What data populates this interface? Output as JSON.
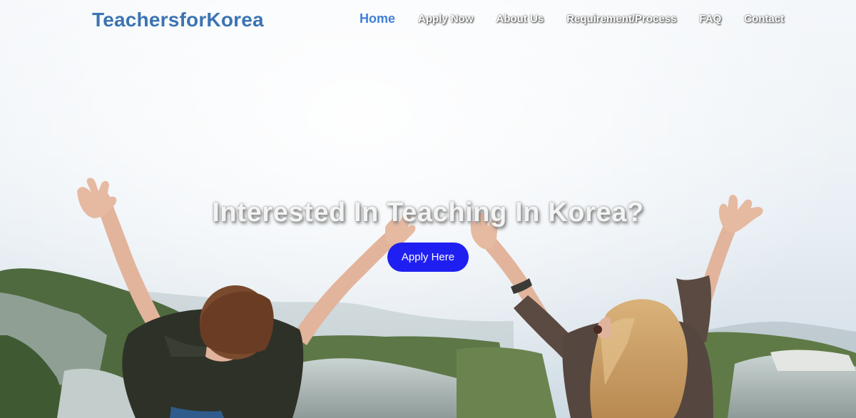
{
  "brand": "TeachersforKorea",
  "nav": {
    "items": [
      "Home",
      "Apply Now",
      "About Us",
      "Requirement/Process",
      "FAQ",
      "Contact"
    ],
    "active": "Home"
  },
  "hero": {
    "headline": "Interested In Teaching In Korea?",
    "cta_label": "Apply Here"
  },
  "colors": {
    "brand": "#3b74b3",
    "active_nav": "#3f7fd8",
    "cta_background": "#1f1ff2"
  }
}
